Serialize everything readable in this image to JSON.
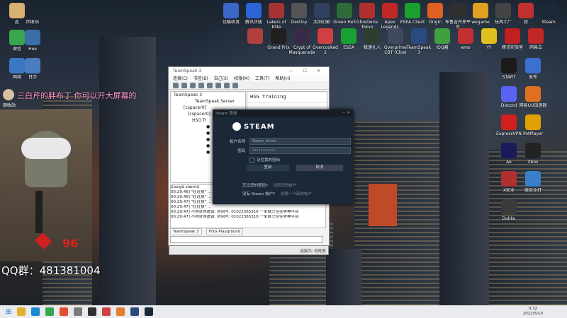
{
  "desktop_icons_left": [
    {
      "label": "此",
      "color": "#d8b070"
    },
    {
      "label": "回收站",
      "color": "#6a8ab0"
    },
    {
      "label": "微信",
      "color": "#36a64f"
    },
    {
      "label": "日历",
      "color": "#4a7cc0"
    },
    {
      "label": "Hoe",
      "color": "#3a6ea8"
    },
    {
      "label": "网络",
      "color": "#3b78c4"
    },
    {
      "label": "回收站",
      "color": "#888888"
    }
  ],
  "desktop_icons_top": [
    {
      "label": "优酷收发",
      "color": "#3a66c8"
    },
    {
      "label": "腾讯正版",
      "color": "#2b65d8"
    },
    {
      "label": "Lakers of Elite",
      "color": "#a83232"
    },
    {
      "label": "Destiny",
      "color": "#555555"
    },
    {
      "label": "太阳幻影",
      "color": "#30405e"
    },
    {
      "label": "Green Hell",
      "color": "#2f6b3a"
    },
    {
      "label": "Ghostwire Tokyo",
      "color": "#b03030"
    },
    {
      "label": "Apex Legends",
      "color": "#c02828"
    },
    {
      "label": "ESEA Client",
      "color": "#18a030"
    },
    {
      "label": "Origin",
      "color": "#e06020"
    },
    {
      "label": "布鲁吉开黑平台",
      "color": "#303030"
    },
    {
      "label": "wegame",
      "color": "#e0a020"
    },
    {
      "label": "玩具工厂",
      "color": "#444444"
    },
    {
      "label": "奴",
      "color": "#c03030"
    },
    {
      "label": "Steam",
      "color": "#1b2838"
    }
  ],
  "desktop_icons_row2": [
    {
      "label": "",
      "color": "#b04040"
    },
    {
      "label": "Grand Prix",
      "color": "#202020"
    },
    {
      "label": "Crypt of Masquerade",
      "color": "#3a2a4a"
    },
    {
      "label": "Overcooked 2",
      "color": "#d04040"
    },
    {
      "label": "ESEA",
      "color": "#18a030"
    },
    {
      "label": "极速扎人",
      "color": "#2e3e2e"
    },
    {
      "label": "Overprime CBT (Clos)",
      "color": "#404860"
    },
    {
      "label": "TeamSpeak 3",
      "color": "#2a4a80"
    },
    {
      "label": "IOQ酱",
      "color": "#40a040"
    },
    {
      "label": "emo",
      "color": "#c03030"
    },
    {
      "label": "YY",
      "color": "#e0c020"
    },
    {
      "label": "腾讯实验室",
      "color": "#c02020"
    },
    {
      "label": "网易云",
      "color": "#c02828"
    }
  ],
  "desktop_icons_right": [
    {
      "label": "START",
      "color": "#1b1b1b"
    },
    {
      "label": "发布",
      "color": "#3a70d0"
    },
    {
      "label": "Discord",
      "color": "#5865f2"
    },
    {
      "label": "网易UU加速器",
      "color": "#e07020"
    },
    {
      "label": "ExpressVPN",
      "color": "#d02020"
    },
    {
      "label": "PotPlayer",
      "color": "#e0a000"
    },
    {
      "label": "Ae",
      "color": "#1a1a5a"
    },
    {
      "label": "Xbox",
      "color": "#222222"
    },
    {
      "label": "X安全",
      "color": "#b03030"
    },
    {
      "label": "微信全打",
      "color": "#3a80c8"
    },
    {
      "label": "Dukku",
      "color": "#3a3a3a"
    }
  ],
  "teamspeak": {
    "title": "TeamSpeak 3",
    "menu": [
      "连接(C)",
      "书签(B)",
      "自己(S)",
      "权限(M)",
      "工具(T)",
      "帮助(H)"
    ],
    "tree": [
      "TeamSpeak 3",
      "TeamSpeak Server",
      "[cspacer0]",
      "[cspacer0]",
      "HSG Tr"
    ],
    "info_title": "HSG  Training",
    "chat_lines": [
      "$lang$ stamt$",
      "00:29:46] \"旺旺敖\" ...",
      "00:29:46] \"旺旺敖\" ...",
      "00:29:47] \"旺旺敖\" ...",
      "00:29:47] \"旺旺敖\" ...",
      "00:29:47] 不得获得邀请: 房间号: 01022365316 一来自只佳佳男神平台",
      "00:29:47] 不得获得邀请: 房间号: 01022365316 一来自只佳佳男神平台"
    ],
    "tabs": [
      "TeamSpeak 3",
      "HSG Playground"
    ],
    "status": "连接为: 旺旺敖"
  },
  "steam": {
    "bar_title": "Steam 登录",
    "logo": "STEAM",
    "account_label": "帐户名称",
    "account_value": "Steam_sharis",
    "password_label": "密码",
    "password_value": "•••••••••••",
    "remember": "记住我的密码",
    "login": "登录",
    "cancel": "取消",
    "forgot": "忘记您的密码?",
    "forgot_link": "找回您的帐户",
    "no_account": "没有 Steam 帐户?",
    "create": "创建一个新的帐户"
  },
  "overlay": {
    "user": "回收站",
    "comment": "三白芹的胖布丁  你可以开大屏幕的",
    "qq": "QQ群：481381004",
    "hp": "96"
  },
  "clock": {
    "time": "0:32",
    "date": "2022/5/10"
  }
}
